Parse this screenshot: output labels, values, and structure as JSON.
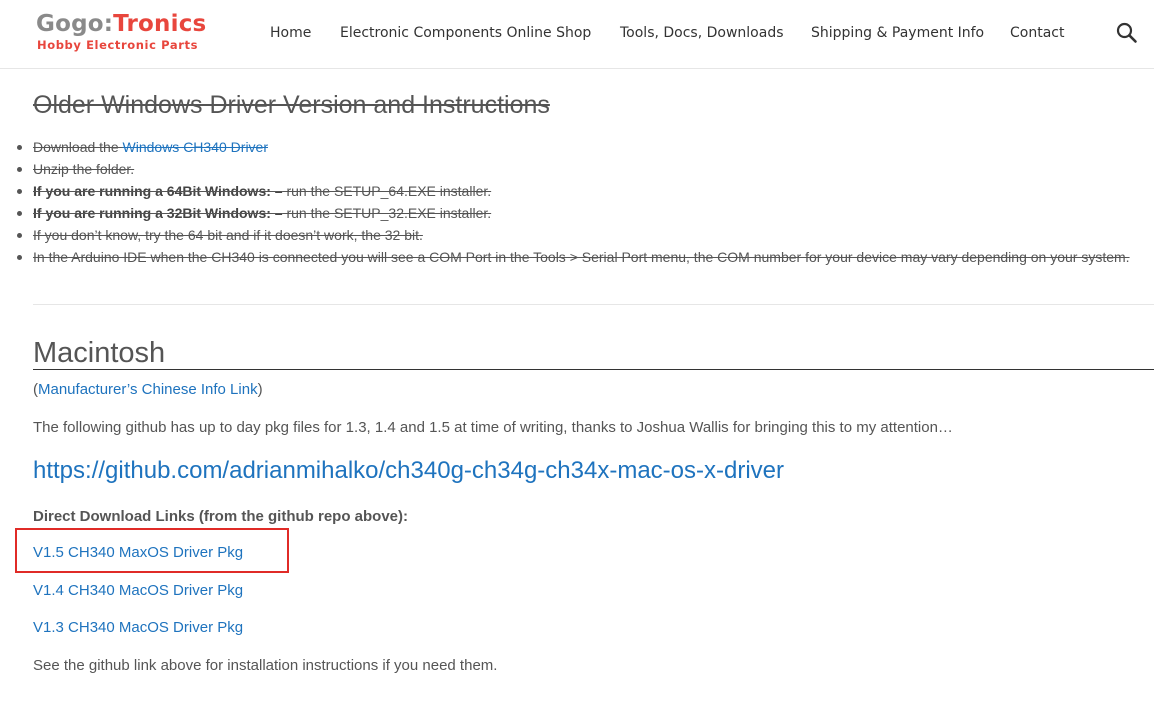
{
  "header": {
    "logo_part1": "Gogo:",
    "logo_part2": "Tronics",
    "logo_tagline": "Hobby Electronic Parts",
    "nav": [
      {
        "label": "Home"
      },
      {
        "label": "Electronic Components Online Shop"
      },
      {
        "label": "Tools, Docs, Downloads"
      },
      {
        "label": "Shipping & Payment Info"
      },
      {
        "label": "Contact"
      }
    ],
    "search_icon": "search-icon"
  },
  "old_windows": {
    "heading": "Older Windows Driver Version and Instructions",
    "step1_prefix": "Download the ",
    "step1_link": "Windows CH340 Driver",
    "step2": "Unzip the folder.",
    "step3_bold": "If you are running a 64Bit Windows: –",
    "step3_rest": " run the SETUP_64.EXE installer.",
    "step4_bold": "If you are running a 32Bit Windows: –",
    "step4_rest": " run the SETUP_32.EXE installer.",
    "step5": "If you don’t know, try the 64 bit and if it doesn’t work, the 32 bit.",
    "step6": "In the Arduino IDE when the CH340 is connected you will see a COM Port in the Tools > Serial Port menu, the COM number for your device may vary depending on your system."
  },
  "mac": {
    "heading": "Macintosh",
    "paren_open": "(",
    "manufacturer_link": "Manufacturer’s Chinese Info Link",
    "paren_close": ")",
    "intro": "The following github has up to day pkg files for 1.3, 1.4 and 1.5 at time of writing, thanks to Joshua Wallis for bringing this to my attention…",
    "github_link": "https://github.com/adrianmihalko/ch340g-ch34g-ch34x-mac-os-x-driver",
    "direct_heading": "Direct Download Links (from the github repo above):",
    "links": [
      {
        "label": "V1.5 CH340 MaxOS Driver Pkg"
      },
      {
        "label": "V1.4 CH340 MacOS Driver Pkg"
      },
      {
        "label": "V1.3 CH340 MacOS Driver Pkg"
      }
    ],
    "footer_note": "See the github link above for installation instructions if you need them."
  },
  "colors": {
    "link": "#1e73be",
    "logo_red": "#e8463d",
    "highlight": "#e02b27"
  }
}
